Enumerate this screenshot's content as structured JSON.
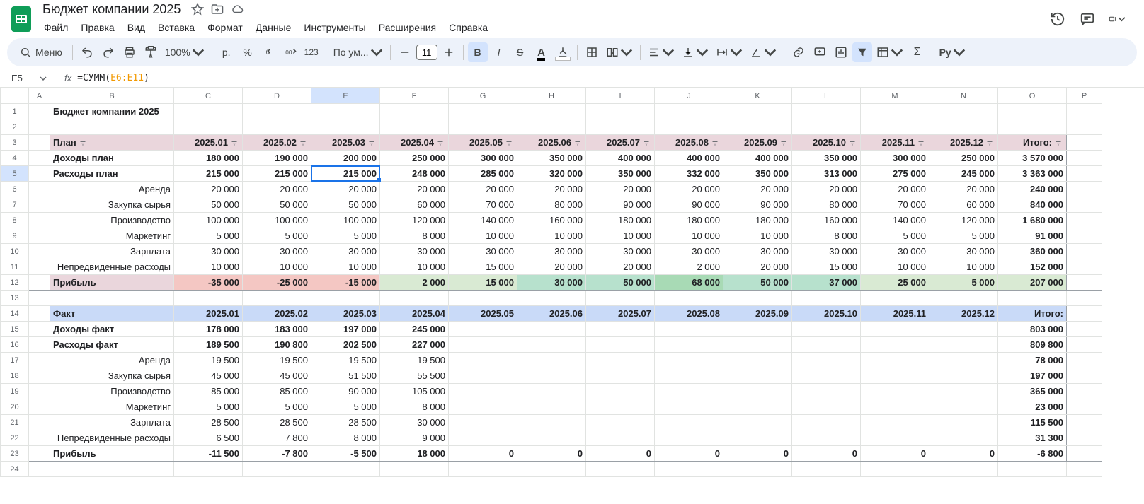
{
  "doc": {
    "title": "Бюджет компании 2025"
  },
  "menu": {
    "file": "Файл",
    "edit": "Правка",
    "view": "Вид",
    "insert": "Вставка",
    "format": "Формат",
    "data": "Данные",
    "tools": "Инструменты",
    "extensions": "Расширения",
    "help": "Справка"
  },
  "toolbar": {
    "search_label": "Меню",
    "zoom": "100%",
    "currency": "р.",
    "percent": "%",
    "dec_dec": ".0",
    "dec_inc": ".00",
    "num123": "123",
    "font_name": "По ум...",
    "font_size": "11",
    "script_label": "Py"
  },
  "fx": {
    "name_box": "E5",
    "prefix": "=СУММ",
    "ref": "E6:E11"
  },
  "columns": [
    "A",
    "B",
    "C",
    "D",
    "E",
    "F",
    "G",
    "H",
    "I",
    "J",
    "K",
    "L",
    "M",
    "N",
    "O",
    "P"
  ],
  "months": [
    "2025.01",
    "2025.02",
    "2025.03",
    "2025.04",
    "2025.05",
    "2025.06",
    "2025.07",
    "2025.08",
    "2025.09",
    "2025.10",
    "2025.11",
    "2025.12"
  ],
  "labels": {
    "sheet_title": "Бюджет компании 2025",
    "plan": "План",
    "fact": "Факт",
    "total": "Итого:",
    "income_plan": "Доходы план",
    "expense_plan": "Расходы план",
    "income_fact": "Доходы факт",
    "expense_fact": "Расходы факт",
    "profit": "Прибыль",
    "rent": "Аренда",
    "raw": "Закупка сырья",
    "prod": "Производство",
    "mkt": "Маркетинг",
    "salary": "Зарплата",
    "unforeseen": "Непредвиденные расходы"
  },
  "plan": {
    "income": [
      "180 000",
      "190 000",
      "200 000",
      "250 000",
      "300 000",
      "350 000",
      "400 000",
      "400 000",
      "400 000",
      "350 000",
      "300 000",
      "250 000",
      "3 570 000"
    ],
    "expense": [
      "215 000",
      "215 000",
      "215 000",
      "248 000",
      "285 000",
      "320 000",
      "350 000",
      "332 000",
      "350 000",
      "313 000",
      "275 000",
      "245 000",
      "3 363 000"
    ],
    "rent": [
      "20 000",
      "20 000",
      "20 000",
      "20 000",
      "20 000",
      "20 000",
      "20 000",
      "20 000",
      "20 000",
      "20 000",
      "20 000",
      "20 000",
      "240 000"
    ],
    "raw": [
      "50 000",
      "50 000",
      "50 000",
      "60 000",
      "70 000",
      "80 000",
      "90 000",
      "90 000",
      "90 000",
      "80 000",
      "70 000",
      "60 000",
      "840 000"
    ],
    "prod": [
      "100 000",
      "100 000",
      "100 000",
      "120 000",
      "140 000",
      "160 000",
      "180 000",
      "180 000",
      "180 000",
      "160 000",
      "140 000",
      "120 000",
      "1 680 000"
    ],
    "mkt": [
      "5 000",
      "5 000",
      "5 000",
      "8 000",
      "10 000",
      "10 000",
      "10 000",
      "10 000",
      "10 000",
      "8 000",
      "5 000",
      "5 000",
      "91 000"
    ],
    "salary": [
      "30 000",
      "30 000",
      "30 000",
      "30 000",
      "30 000",
      "30 000",
      "30 000",
      "30 000",
      "30 000",
      "30 000",
      "30 000",
      "30 000",
      "360 000"
    ],
    "unforeseen": [
      "10 000",
      "10 000",
      "10 000",
      "10 000",
      "15 000",
      "20 000",
      "20 000",
      "2 000",
      "20 000",
      "15 000",
      "10 000",
      "10 000",
      "152 000"
    ],
    "profit": [
      "-35 000",
      "-25 000",
      "-15 000",
      "2 000",
      "15 000",
      "30 000",
      "50 000",
      "68 000",
      "50 000",
      "37 000",
      "25 000",
      "5 000",
      "207 000"
    ]
  },
  "fact": {
    "income": [
      "178 000",
      "183 000",
      "197 000",
      "245 000",
      "",
      "",
      "",
      "",
      "",
      "",
      "",
      "",
      "803 000"
    ],
    "expense": [
      "189 500",
      "190 800",
      "202 500",
      "227 000",
      "",
      "",
      "",
      "",
      "",
      "",
      "",
      "",
      "809 800"
    ],
    "rent": [
      "19 500",
      "19 500",
      "19 500",
      "19 500",
      "",
      "",
      "",
      "",
      "",
      "",
      "",
      "",
      "78 000"
    ],
    "raw": [
      "45 000",
      "45 000",
      "51 500",
      "55 500",
      "",
      "",
      "",
      "",
      "",
      "",
      "",
      "",
      "197 000"
    ],
    "prod": [
      "85 000",
      "85 000",
      "90 000",
      "105 000",
      "",
      "",
      "",
      "",
      "",
      "",
      "",
      "",
      "365 000"
    ],
    "mkt": [
      "5 000",
      "5 000",
      "5 000",
      "8 000",
      "",
      "",
      "",
      "",
      "",
      "",
      "",
      "",
      "23 000"
    ],
    "salary": [
      "28 500",
      "28 500",
      "28 500",
      "30 000",
      "",
      "",
      "",
      "",
      "",
      "",
      "",
      "",
      "115 500"
    ],
    "unforeseen": [
      "6 500",
      "7 800",
      "8 000",
      "9 000",
      "",
      "",
      "",
      "",
      "",
      "",
      "",
      "",
      "31 300"
    ],
    "profit": [
      "-11 500",
      "-7 800",
      "-5 500",
      "18 000",
      "0",
      "0",
      "0",
      "0",
      "0",
      "0",
      "0",
      "0",
      "-6 800"
    ]
  },
  "active_cell": {
    "col_index": 5,
    "row_index": 5
  }
}
